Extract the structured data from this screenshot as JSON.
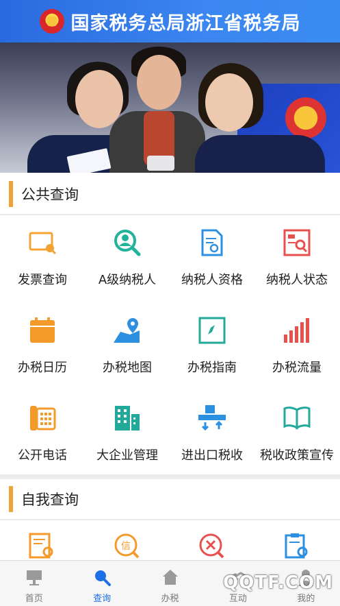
{
  "header": {
    "title": "国家税务总局浙江省税务局"
  },
  "public_section": {
    "title": "公共查询",
    "items": [
      {
        "label": "发票查询",
        "icon": "invoice-search-icon"
      },
      {
        "label": "A级纳税人",
        "icon": "person-search-icon"
      },
      {
        "label": "纳税人资格",
        "icon": "document-search-icon"
      },
      {
        "label": "纳税人状态",
        "icon": "report-search-icon"
      },
      {
        "label": "办税日历",
        "icon": "calendar-icon"
      },
      {
        "label": "办税地图",
        "icon": "map-pin-icon"
      },
      {
        "label": "办税指南",
        "icon": "compass-icon"
      },
      {
        "label": "办税流量",
        "icon": "bar-chart-icon"
      },
      {
        "label": "公开电话",
        "icon": "telephone-icon"
      },
      {
        "label": "大企业管理",
        "icon": "buildings-icon"
      },
      {
        "label": "进出口税收",
        "icon": "import-export-icon"
      },
      {
        "label": "税收政策宣传",
        "icon": "open-book-icon"
      }
    ]
  },
  "self_section": {
    "title": "自我查询",
    "items": [
      {
        "icon": "list-search-icon"
      },
      {
        "icon": "credit-search-icon"
      },
      {
        "icon": "cancel-search-icon"
      },
      {
        "icon": "clipboard-search-icon"
      }
    ]
  },
  "tabbar": {
    "items": [
      {
        "label": "首页",
        "icon": "home-board-icon",
        "active": false
      },
      {
        "label": "查询",
        "icon": "search-icon",
        "active": true
      },
      {
        "label": "办税",
        "icon": "house-icon",
        "active": false
      },
      {
        "label": "互动",
        "icon": "handshake-icon",
        "active": false
      },
      {
        "label": "我的",
        "icon": "user-icon",
        "active": false
      }
    ]
  },
  "watermark": "QQTF.COM",
  "colors": {
    "header_blue": "#2f78e8",
    "accent_orange": "#f3a333",
    "active_blue": "#1d6fe6"
  }
}
